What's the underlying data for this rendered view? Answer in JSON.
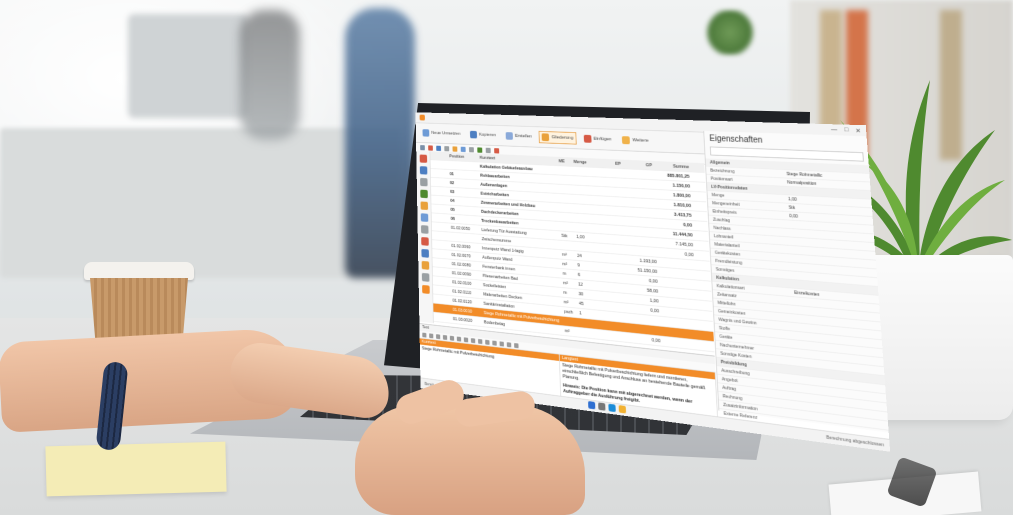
{
  "app": {
    "properties_title": "Eigenschaften",
    "ribbon": [
      {
        "label": "Neue Umsetzen",
        "color": "#6e9bd6"
      },
      {
        "label": "Kopieren",
        "color": "#4d7fc2"
      },
      {
        "label": "Erstellen",
        "color": "#8aa9d9"
      },
      {
        "label": "Gliederung",
        "color": "#e9a13b"
      },
      {
        "label": "Einfügen",
        "color": "#d65a45"
      },
      {
        "label": "Weitere",
        "color": "#f0b24a"
      }
    ],
    "grid_header": [
      "",
      "",
      "Position",
      "Kurztext",
      "ME",
      "Menge",
      "EP",
      "GP",
      "Summe"
    ],
    "grid_rows": [
      {
        "c": [
          "",
          "",
          "",
          "Kalkulation Gebäudeausbau",
          "",
          "",
          "",
          "",
          "885.801,25"
        ],
        "style": "bold"
      },
      {
        "c": [
          "",
          "",
          "01",
          "Rohbauarbeiten",
          "",
          "",
          "",
          "",
          "1.150,00"
        ],
        "style": "bold"
      },
      {
        "c": [
          "",
          "",
          "02",
          "Außenanlagen",
          "",
          "",
          "",
          "",
          "1.800,00"
        ],
        "style": "bold"
      },
      {
        "c": [
          "",
          "",
          "03",
          "Estricharbeiten",
          "",
          "",
          "",
          "",
          "1.810,00"
        ],
        "style": "bold"
      },
      {
        "c": [
          "",
          "",
          "04",
          "Zimmerarbeiten und Holzbau",
          "",
          "",
          "",
          "",
          "3.413,75"
        ],
        "style": "bold"
      },
      {
        "c": [
          "",
          "",
          "05",
          "Dachdeckerarbeiten",
          "",
          "",
          "",
          "",
          "0,00"
        ],
        "style": "bold"
      },
      {
        "c": [
          "",
          "",
          "06",
          "Trockenbauarbeiten",
          "",
          "",
          "",
          "",
          "11.444,50"
        ],
        "style": "bold"
      },
      {
        "c": [
          "",
          "",
          "01.02.0050",
          "Lieferung Tür Ausstattung",
          "Stk",
          "1,00",
          "",
          "",
          "7.145,00"
        ],
        "style": ""
      },
      {
        "c": [
          "",
          "",
          "",
          "Zwischensumme",
          "",
          "",
          "",
          "",
          "0,00"
        ],
        "style": ""
      },
      {
        "c": [
          "",
          "",
          "01.02.0060",
          "Innenputz Wand 1-lagig",
          "m²",
          "24",
          "",
          "1.193,00",
          ""
        ],
        "style": ""
      },
      {
        "c": [
          "",
          "",
          "01.02.0070",
          "Außenputz Wand",
          "m²",
          "9",
          "",
          "51.150,00",
          ""
        ],
        "style": ""
      },
      {
        "c": [
          "",
          "",
          "01.02.0080",
          "Fensterbank innen",
          "m",
          "6",
          "",
          "0,00",
          ""
        ],
        "style": ""
      },
      {
        "c": [
          "",
          "",
          "01.02.0090",
          "Fliesenarbeiten Bad",
          "m²",
          "12",
          "",
          "58,00",
          ""
        ],
        "style": ""
      },
      {
        "c": [
          "",
          "",
          "01.02.0100",
          "Sockelleisten",
          "m",
          "30",
          "",
          "1,00",
          ""
        ],
        "style": ""
      },
      {
        "c": [
          "",
          "",
          "01.02.0110",
          "Malerarbeiten Decken",
          "m²",
          "45",
          "",
          "0,00",
          ""
        ],
        "style": ""
      },
      {
        "c": [
          "",
          "",
          "01.02.0120",
          "Sanitärinstallation",
          "psch",
          "1",
          "",
          "",
          ""
        ],
        "style": ""
      },
      {
        "c": [
          "",
          "",
          "01.03.0010",
          "Stege Rohmetallic mit Pulverbeschichtung",
          "",
          "",
          "",
          "",
          ""
        ],
        "style": "sel"
      },
      {
        "c": [
          "",
          "",
          "01.03.0020",
          "Bodenbelag",
          "m²",
          "",
          "",
          "0,00",
          ""
        ],
        "style": ""
      },
      {
        "c": [
          "",
          "",
          "01.03.0030",
          "Treppenstufen",
          "Stk",
          "",
          "",
          "0,00",
          ""
        ],
        "style": ""
      },
      {
        "c": [
          "",
          "",
          "01.03.0040",
          "Geländer",
          "m",
          "",
          "",
          "0,00",
          ""
        ],
        "style": ""
      },
      {
        "c": [
          "",
          "",
          "01.03.0050",
          "Handlauf",
          "m",
          "",
          "",
          "0,00",
          ""
        ],
        "style": ""
      }
    ],
    "properties": [
      {
        "k": "Allgemein",
        "v": "",
        "section": true
      },
      {
        "k": "Bezeichnung",
        "v": "Stege Rohmetallic",
        "section": false
      },
      {
        "k": "Positionsart",
        "v": "Normalposition",
        "section": false
      },
      {
        "k": "LV-Positionsdaten",
        "v": "",
        "section": true
      },
      {
        "k": "Menge",
        "v": "1,00",
        "section": false
      },
      {
        "k": "Mengeneinheit",
        "v": "Stk",
        "section": false
      },
      {
        "k": "Einheitspreis",
        "v": "0,00",
        "section": false
      },
      {
        "k": "Zuschlag",
        "v": "",
        "section": false
      },
      {
        "k": "Nachlass",
        "v": "",
        "section": false
      },
      {
        "k": "Lohnanteil",
        "v": "",
        "section": false
      },
      {
        "k": "Materialanteil",
        "v": "",
        "section": false
      },
      {
        "k": "Gerätekosten",
        "v": "",
        "section": false
      },
      {
        "k": "Fremdleistung",
        "v": "",
        "section": false
      },
      {
        "k": "Sonstiges",
        "v": "",
        "section": false
      },
      {
        "k": "Kalkulation",
        "v": "",
        "section": true
      },
      {
        "k": "Kalkulationsart",
        "v": "Einzelkosten",
        "section": false
      },
      {
        "k": "Zeitansatz",
        "v": "",
        "section": false
      },
      {
        "k": "Mittellohn",
        "v": "",
        "section": false
      },
      {
        "k": "Gemeinkosten",
        "v": "",
        "section": false
      },
      {
        "k": "Wagnis und Gewinn",
        "v": "",
        "section": false
      },
      {
        "k": "Stoffe",
        "v": "",
        "section": false
      },
      {
        "k": "Geräte",
        "v": "",
        "section": false
      },
      {
        "k": "Nachunternehmer",
        "v": "",
        "section": false
      },
      {
        "k": "Sonstige Kosten",
        "v": "",
        "section": false
      },
      {
        "k": "Preisbildung",
        "v": "",
        "section": true
      },
      {
        "k": "Ausschreibung",
        "v": "",
        "section": false
      },
      {
        "k": "Angebot",
        "v": "",
        "section": false
      },
      {
        "k": "Auftrag",
        "v": "",
        "section": false
      },
      {
        "k": "Rechnung",
        "v": "",
        "section": false
      },
      {
        "k": "Zusatzinformation",
        "v": "",
        "section": false
      },
      {
        "k": "Externe Referenz",
        "v": "",
        "section": false
      },
      {
        "k": "Bemerkung",
        "v": "",
        "section": false
      },
      {
        "k": "Verknüpfung",
        "v": "",
        "section": false
      },
      {
        "k": "Abschluss",
        "v": "",
        "section": false
      }
    ],
    "bottom": {
      "tab_label": "Text",
      "left_head": "Kurztext",
      "left_text": "Stege Rohmetallic mit Pulverbeschichtung",
      "right_head": "Langtext",
      "right_text_1": "Stege Rohmetallic mit Pulverbeschichtung liefern und montieren, einschließlich Befestigung und Anschluss an bestehende Bauteile gemäß Planung.",
      "right_text_2": "Hinweis: Die Position kann mit abgerechnet werden, wenn der Auftraggeber die Ausführung freigibt."
    },
    "status_left": "Bereit",
    "status_right": "Berechnung abgeschlossen"
  },
  "colors": {
    "accent": "#f28c28",
    "screen_bg": "#ffffff",
    "laptop": "#1f2125"
  }
}
